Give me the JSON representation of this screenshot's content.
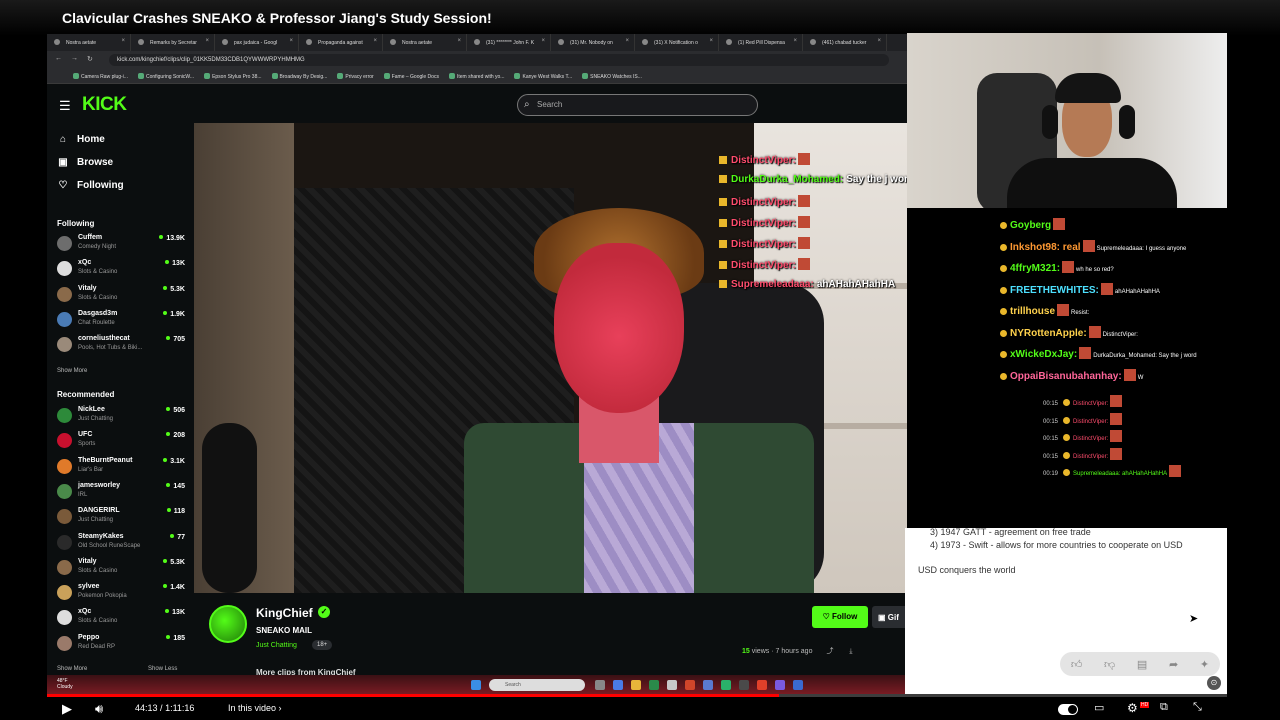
{
  "video": {
    "title": "Clavicular Crashes SNEAKO & Professor Jiang's Study Session!",
    "time_current": "44:13",
    "time_total": "1:11:16",
    "time_sep": "/",
    "chapter": "In this video",
    "progress": 0.62
  },
  "browser": {
    "tabs": [
      "Nostra aetate",
      "Remarks by Secretar",
      "pax judaica - Googl",
      "Propaganda against",
      "Nostra aetate",
      "(31) ******** John F. K",
      "(31) Mr. Nobody on",
      "(31) X Notification o",
      "(1) Red Pill Dispensa",
      "(461) chabad tucker"
    ],
    "url": "kick.com/kingchief/clips/clip_01KK5DM33CDB1QYWWWRPYHMHMG",
    "bookmarks": [
      "Camera Raw plug-i...",
      "Configuring SonicW...",
      "Epson Stylus Pro 38...",
      "Broadway By Desig...",
      "Privacy error",
      "Fame – Google Docs",
      "Item shared with yo...",
      "Kanye West Walks T...",
      "SNEAKO Watches IS..."
    ]
  },
  "kick": {
    "logo": "KICK",
    "search_placeholder": "Search",
    "nav": [
      "Home",
      "Browse",
      "Following"
    ],
    "following_label": "Following",
    "following": [
      {
        "name": "Cuffem",
        "cat": "Comedy Night",
        "count": "13.9K",
        "color": "#6d6d6d"
      },
      {
        "name": "xQc",
        "cat": "Slots & Casino",
        "count": "13K",
        "color": "#dddddd"
      },
      {
        "name": "Vitaly",
        "cat": "Slots & Casino",
        "count": "5.3K",
        "color": "#8a6a4a"
      },
      {
        "name": "Dasgasd3m",
        "cat": "Chat Roulette",
        "count": "1.9K",
        "color": "#4a7bb5"
      },
      {
        "name": "corneliusthecat",
        "cat": "Pools, Hot Tubs & Biki...",
        "count": "705",
        "color": "#9a8a7a"
      }
    ],
    "show_more": "Show More",
    "show_less": "Show Less",
    "recommended_label": "Recommended",
    "recommended": [
      {
        "name": "NickLee",
        "cat": "Just Chatting",
        "count": "506",
        "color": "#2d8a3a"
      },
      {
        "name": "UFC",
        "cat": "Sports",
        "count": "208",
        "color": "#c8102e"
      },
      {
        "name": "TheBurntPeanut",
        "cat": "Liar's Bar",
        "count": "3.1K",
        "color": "#e07a2a"
      },
      {
        "name": "jamesworley",
        "cat": "IRL",
        "count": "145",
        "color": "#4a8a4a"
      },
      {
        "name": "DANGERIRL",
        "cat": "Just Chatting",
        "count": "118",
        "color": "#7a5a3a"
      },
      {
        "name": "SteamyKakes",
        "cat": "Old School RuneScape",
        "count": "77",
        "color": "#2a2a2a"
      },
      {
        "name": "Vitaly",
        "cat": "Slots & Casino",
        "count": "5.3K",
        "color": "#8a6a4a"
      },
      {
        "name": "sylvee",
        "cat": "Pokemon Pokopia",
        "count": "1.4K",
        "color": "#c9a15a"
      },
      {
        "name": "xQc",
        "cat": "Slots & Casino",
        "count": "13K",
        "color": "#dddddd"
      },
      {
        "name": "Peppo",
        "cat": "Red Dead RP",
        "count": "185",
        "color": "#9a7a6a"
      }
    ],
    "channel": {
      "name": "KingChief",
      "title": "SNEAKO MAIL",
      "category": "Just Chatting",
      "tag": "18+",
      "follow": "Follow",
      "gift": "Gif",
      "views_num": "15",
      "views_label": "views",
      "age": "7 hours ago",
      "more": "More clips from KingChief"
    }
  },
  "overlay_chat": [
    {
      "name": "DistinctViper:",
      "msg": "",
      "color": "#ff4d6d"
    },
    {
      "name": "DurkaDurka_Mohamed:",
      "msg": "Say the j word",
      "color": "#53fc18"
    },
    {
      "name": "DistinctViper:",
      "msg": "",
      "color": "#ff4d6d"
    },
    {
      "name": "DistinctViper:",
      "msg": "",
      "color": "#ff4d6d"
    },
    {
      "name": "DistinctViper:",
      "msg": "",
      "color": "#ff4d6d"
    },
    {
      "name": "DistinctViper:",
      "msg": "",
      "color": "#ff4d6d"
    },
    {
      "name": "Supremeleadaaa:",
      "msg": "ahAHahAHahHA",
      "color": "#ff4d6d"
    }
  ],
  "right_chat": {
    "big": [
      {
        "name": "Goyberg",
        "msg": "",
        "color": "#53fc18"
      },
      {
        "name": "Inkshot98: real",
        "msg": "Supremeleadaaa: I guess anyone",
        "color": "#ff9933"
      },
      {
        "name": "4ffryM321:",
        "msg": "wh he so red?",
        "color": "#53fc18"
      },
      {
        "name": "FREETHEWHITES:",
        "msg": "ahAHahAHahHA",
        "color": "#4de0ff"
      },
      {
        "name": "trillhouse",
        "msg": "Resist:",
        "color": "#ffd24d"
      },
      {
        "name": "NYRottenApple:",
        "msg": "DistinctViper:",
        "color": "#ffd24d"
      },
      {
        "name": "xWickeDxJay:",
        "msg": "DurkaDurka_Mohamed: Say the j word",
        "color": "#53fc18"
      },
      {
        "name": "OppaiBisanubahanhay:",
        "msg": "W",
        "color": "#ff6699"
      }
    ],
    "small": [
      {
        "time": "00:15",
        "name": "DistinctViper:",
        "cls": "rn"
      },
      {
        "time": "00:15",
        "name": "DistinctViper:",
        "cls": "rn"
      },
      {
        "time": "00:15",
        "name": "DistinctViper:",
        "cls": "rn"
      },
      {
        "time": "00:15",
        "name": "DistinctViper:",
        "cls": "rn"
      },
      {
        "time": "00:19",
        "name": "Supremeleadaaa: ahAHahAHahHA",
        "cls": "gn"
      }
    ]
  },
  "doc": {
    "line1": "3)  1947 GATT - agreement on free trade",
    "line2": "4)  1973 - Swift - allows for more countries to cooperate on USD",
    "line3": "USD conquers the world"
  },
  "taskbar": {
    "temp": "48°F",
    "weather": "Cloudy",
    "search": "Search"
  }
}
